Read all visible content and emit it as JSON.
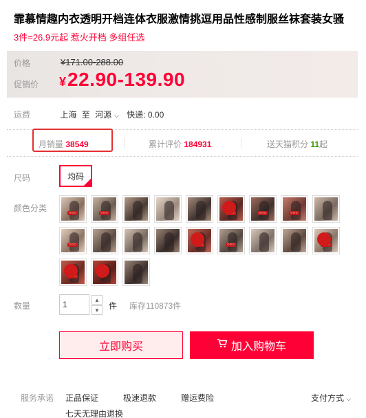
{
  "product": {
    "title": "霏慕情趣内衣透明开档连体衣服激情挑逗用品性感制服丝袜套装女骚",
    "subtitle": "3件=26.9元起 惹火开档 多组任选"
  },
  "price": {
    "label": "价格",
    "original": "¥171.00-288.00",
    "promo_label": "促销价",
    "currency": "¥",
    "promo": "22.90-139.90"
  },
  "shipping": {
    "label": "运费",
    "from": "上海",
    "to_word": "至",
    "to": "河源",
    "cost": "快递: 0.00"
  },
  "stats": {
    "monthly_sales_label": "月销量",
    "monthly_sales": "38549",
    "reviews_label": "累计评价",
    "reviews": "184931",
    "points_label": "送天猫积分",
    "points": "11",
    "points_unit": "起"
  },
  "size": {
    "label": "尺码",
    "option": "均码"
  },
  "color": {
    "label": "颜色分类"
  },
  "quantity": {
    "label": "数量",
    "value": "1",
    "unit": "件",
    "stock": "库存110873件"
  },
  "buttons": {
    "buy": "立即购买",
    "cart": "加入购物车"
  },
  "service": {
    "label": "服务承诺",
    "items": [
      "正品保证",
      "极速退款",
      "赠运费险",
      "七天无理由退换"
    ],
    "payment": "支付方式"
  },
  "colors": {
    "accent": "#ff0036",
    "highlight_box": "#e53030",
    "points_green": "#339900"
  }
}
